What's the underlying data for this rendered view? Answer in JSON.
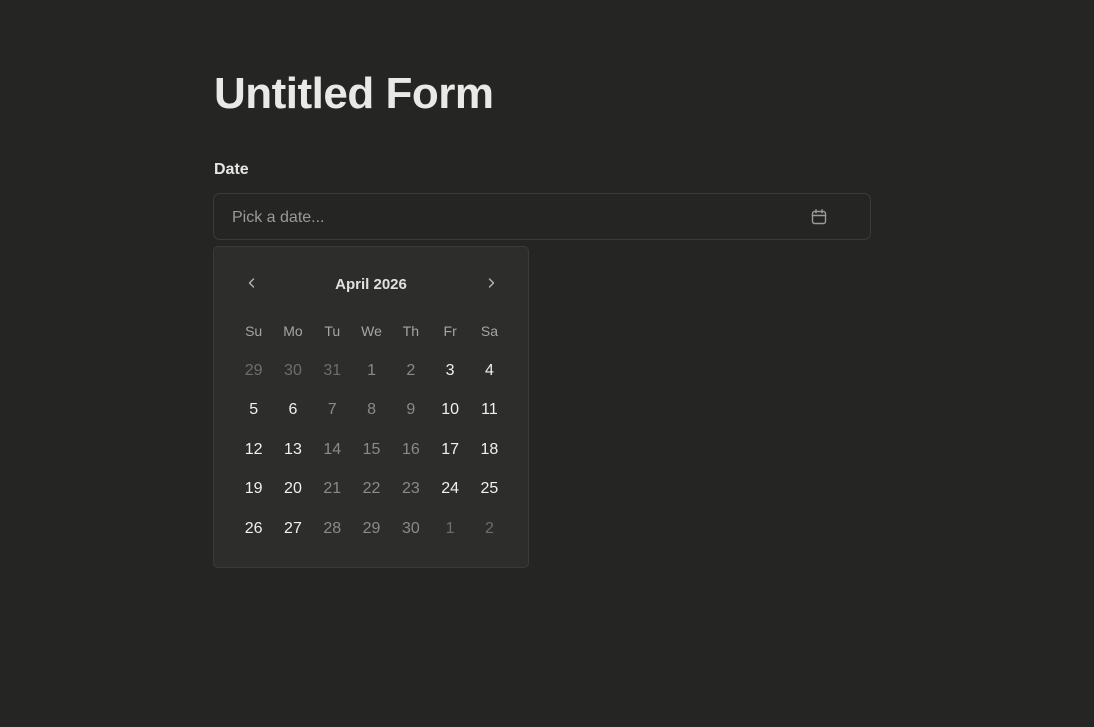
{
  "form": {
    "title": "Untitled Form"
  },
  "date_field": {
    "label": "Date",
    "placeholder": "Pick a date...",
    "icon": "calendar-icon"
  },
  "calendar": {
    "month_label": "April 2026",
    "prev_icon": "chevron-left-icon",
    "next_icon": "chevron-right-icon",
    "weekdays": [
      "Su",
      "Mo",
      "Tu",
      "We",
      "Th",
      "Fr",
      "Sa"
    ],
    "weeks": [
      [
        {
          "label": "29",
          "state": "outside"
        },
        {
          "label": "30",
          "state": "outside"
        },
        {
          "label": "31",
          "state": "outside"
        },
        {
          "label": "1",
          "state": "disabled"
        },
        {
          "label": "2",
          "state": "disabled"
        },
        {
          "label": "3",
          "state": "enabled"
        },
        {
          "label": "4",
          "state": "enabled"
        }
      ],
      [
        {
          "label": "5",
          "state": "enabled"
        },
        {
          "label": "6",
          "state": "enabled"
        },
        {
          "label": "7",
          "state": "disabled"
        },
        {
          "label": "8",
          "state": "disabled"
        },
        {
          "label": "9",
          "state": "disabled"
        },
        {
          "label": "10",
          "state": "enabled"
        },
        {
          "label": "11",
          "state": "enabled"
        }
      ],
      [
        {
          "label": "12",
          "state": "enabled"
        },
        {
          "label": "13",
          "state": "enabled"
        },
        {
          "label": "14",
          "state": "disabled"
        },
        {
          "label": "15",
          "state": "disabled"
        },
        {
          "label": "16",
          "state": "disabled"
        },
        {
          "label": "17",
          "state": "enabled"
        },
        {
          "label": "18",
          "state": "enabled"
        }
      ],
      [
        {
          "label": "19",
          "state": "enabled"
        },
        {
          "label": "20",
          "state": "enabled"
        },
        {
          "label": "21",
          "state": "disabled"
        },
        {
          "label": "22",
          "state": "disabled"
        },
        {
          "label": "23",
          "state": "disabled"
        },
        {
          "label": "24",
          "state": "enabled"
        },
        {
          "label": "25",
          "state": "enabled"
        }
      ],
      [
        {
          "label": "26",
          "state": "enabled"
        },
        {
          "label": "27",
          "state": "enabled"
        },
        {
          "label": "28",
          "state": "disabled"
        },
        {
          "label": "29",
          "state": "disabled"
        },
        {
          "label": "30",
          "state": "disabled"
        },
        {
          "label": "1",
          "state": "outside"
        },
        {
          "label": "2",
          "state": "outside"
        }
      ]
    ]
  },
  "colors": {
    "background": "#252523",
    "popover_background": "#2d2d2b",
    "border": "#3b3b39",
    "text_primary": "#f0f0ee",
    "text_muted": "#8a8a88",
    "text_outside": "#6e6e6c"
  }
}
